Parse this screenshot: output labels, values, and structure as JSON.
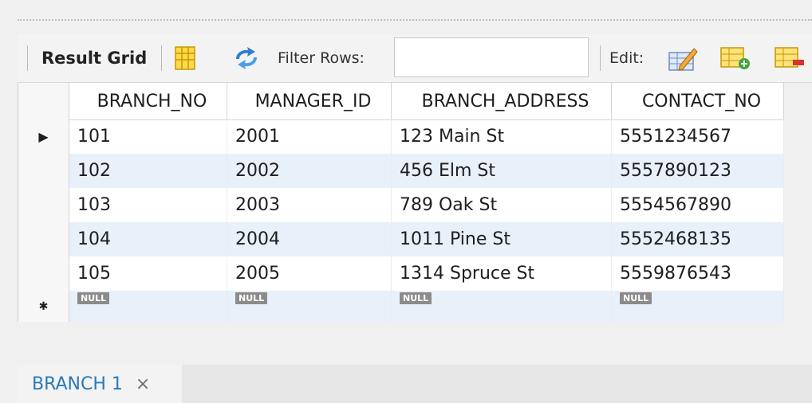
{
  "toolbar": {
    "result_grid_label": "Result Grid",
    "filter_label": "Filter Rows:",
    "filter_value": "",
    "edit_label": "Edit:"
  },
  "grid": {
    "columns": [
      "BRANCH_NO",
      "MANAGER_ID",
      "BRANCH_ADDRESS",
      "CONTACT_NO"
    ],
    "rows": [
      [
        "101",
        "2001",
        "123 Main St",
        "5551234567"
      ],
      [
        "102",
        "2002",
        "456 Elm St",
        "5557890123"
      ],
      [
        "103",
        "2003",
        "789 Oak St",
        "5554567890"
      ],
      [
        "104",
        "2004",
        "1011 Pine St",
        "5552468135"
      ],
      [
        "105",
        "2005",
        "1314 Spruce St",
        "5559876543"
      ]
    ],
    "null_label": "NULL",
    "current_row_marker": "▶",
    "new_row_marker": "✱"
  },
  "tabs": [
    {
      "label": "BRANCH 1",
      "close": "×"
    }
  ],
  "colors": {
    "alt_row": "#e8f0fa",
    "tab_text": "#2a78b8"
  }
}
